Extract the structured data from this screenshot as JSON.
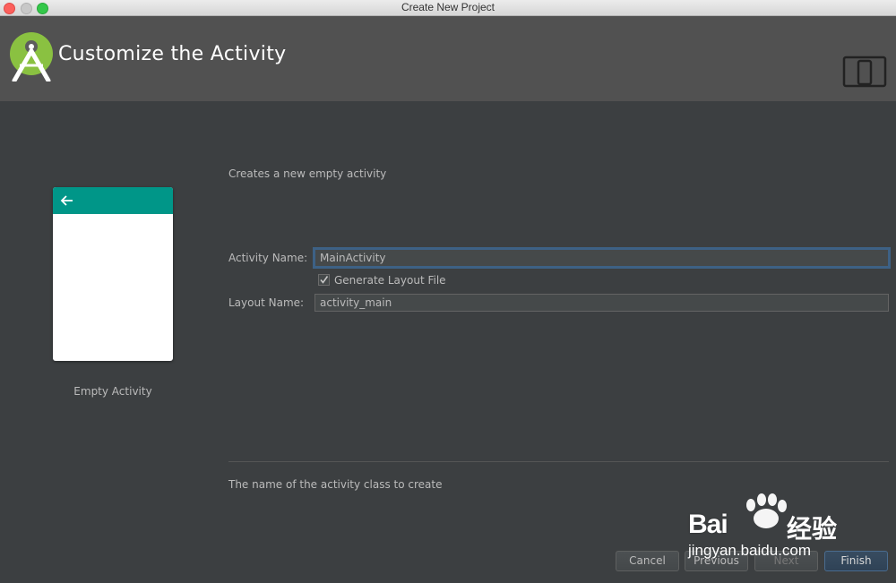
{
  "window": {
    "title": "Create New Project"
  },
  "header": {
    "title": "Customize the Activity",
    "logo_icon": "android-studio-icon",
    "device_icon": "phone-tablet-icon"
  },
  "preview": {
    "template_name": "Empty Activity",
    "accent": "#009688"
  },
  "form": {
    "description": "Creates a new empty activity",
    "activity_name_label": "Activity Name:",
    "activity_name_value": "MainActivity",
    "generate_layout_label": "Generate Layout File",
    "generate_layout_checked": true,
    "layout_name_label": "Layout Name:",
    "layout_name_value": "activity_main",
    "hint": "The name of the activity class to create"
  },
  "buttons": {
    "cancel": "Cancel",
    "previous": "Previous",
    "next": "Next",
    "finish": "Finish"
  },
  "watermark": {
    "brand": "Bai",
    "brand_cn": "经验",
    "url": "jingyan.baidu.com"
  }
}
